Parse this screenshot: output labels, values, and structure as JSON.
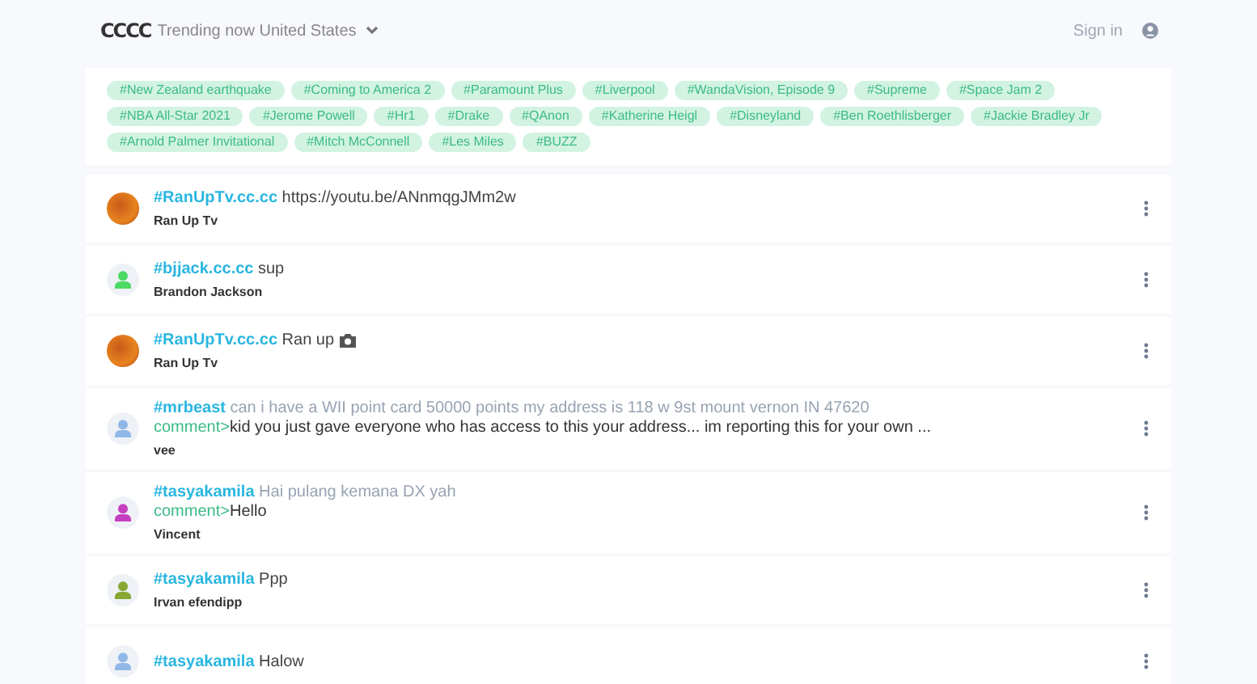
{
  "header": {
    "logo": "CCCC",
    "title": "Trending now United States",
    "sign_in": "Sign in"
  },
  "trending_tags": [
    "#New Zealand earthquake",
    "#Coming to America 2",
    "#Paramount Plus",
    "#Liverpool",
    "#WandaVision, Episode 9",
    "#Supreme",
    "#Space Jam 2",
    "#NBA All-Star 2021",
    "#Jerome Powell",
    "#Hr1",
    "#Drake",
    "#QAnon",
    "#Katherine Heigl",
    "#Disneyland",
    "#Ben Roethlisberger",
    "#Jackie Bradley Jr",
    "#Arnold Palmer Invitational",
    "#Mitch McConnell",
    "#Les Miles",
    "#BUZZ"
  ],
  "posts": [
    {
      "avatar": {
        "kind": "photo"
      },
      "tag": "#RanUpTv.cc.cc",
      "text": "https://youtu.be/ANnmqgJMm2w",
      "dimmed": false,
      "camera": false,
      "author": "Ran Up Tv"
    },
    {
      "avatar": {
        "kind": "silhouette",
        "color": "#4cd964"
      },
      "tag": "#bjjack.cc.cc",
      "text": "sup",
      "dimmed": false,
      "camera": false,
      "author": "Brandon Jackson"
    },
    {
      "avatar": {
        "kind": "photo"
      },
      "tag": "#RanUpTv.cc.cc",
      "text": "Ran up",
      "dimmed": false,
      "camera": true,
      "author": "Ran Up Tv"
    },
    {
      "avatar": {
        "kind": "silhouette",
        "color": "#8fb8e8"
      },
      "tag": "#mrbeast",
      "text": "can i have a WII point card 50000 points my address is 118 w 9st mount vernon IN 47620",
      "dimmed": true,
      "camera": false,
      "comment": {
        "label": "comment>",
        "text": "kid you just gave everyone who has access to this your address... im reporting this for your own ..."
      },
      "author": "vee"
    },
    {
      "avatar": {
        "kind": "silhouette",
        "color": "#c43fbf"
      },
      "tag": "#tasyakamila",
      "text": "Hai pulang kemana DX yah",
      "dimmed": true,
      "camera": false,
      "comment": {
        "label": "comment>",
        "text": "Hello"
      },
      "author": "Vincent"
    },
    {
      "avatar": {
        "kind": "silhouette",
        "color": "#86a832"
      },
      "tag": "#tasyakamila",
      "text": "Ppp",
      "dimmed": false,
      "camera": false,
      "author": "Irvan efendipp"
    },
    {
      "avatar": {
        "kind": "silhouette",
        "color": "#8fb8e8"
      },
      "tag": "#tasyakamila",
      "text": "Halow",
      "dimmed": false,
      "camera": false
    }
  ]
}
